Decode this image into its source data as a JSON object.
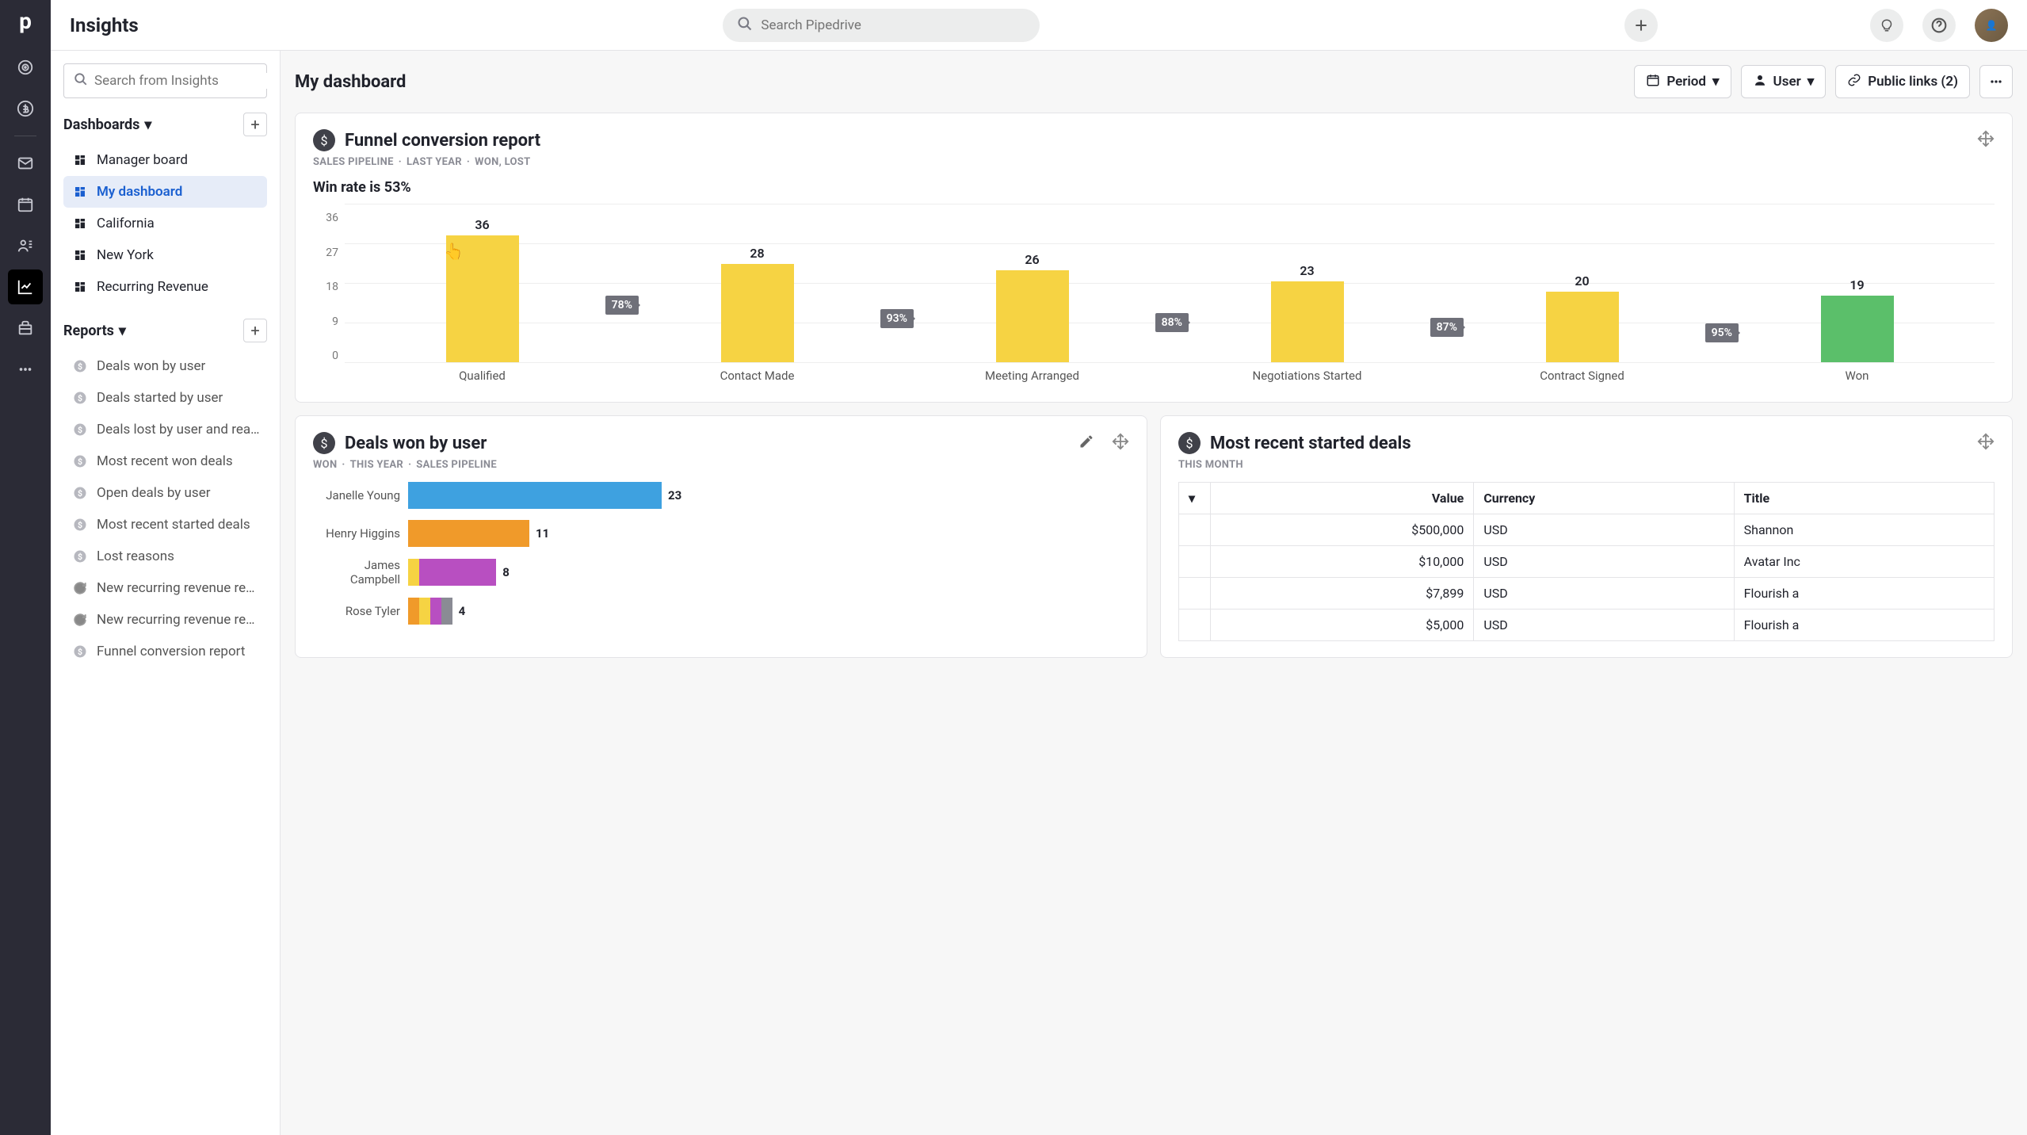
{
  "app": {
    "page_title": "Insights",
    "search_placeholder": "Search Pipedrive"
  },
  "sidebar": {
    "search_placeholder": "Search from Insights",
    "dashboards_label": "Dashboards",
    "reports_label": "Reports",
    "dashboards": [
      {
        "label": "Manager board"
      },
      {
        "label": "My dashboard",
        "active": true
      },
      {
        "label": "California"
      },
      {
        "label": "New York"
      },
      {
        "label": "Recurring Revenue"
      }
    ],
    "reports": [
      {
        "label": "Deals won by user",
        "icon": "dollar"
      },
      {
        "label": "Deals started by user",
        "icon": "dollar"
      },
      {
        "label": "Deals lost by user and rea…",
        "icon": "dollar"
      },
      {
        "label": "Most recent won deals",
        "icon": "dollar"
      },
      {
        "label": "Open deals by user",
        "icon": "dollar"
      },
      {
        "label": "Most recent started deals",
        "icon": "dollar"
      },
      {
        "label": "Lost reasons",
        "icon": "dollar"
      },
      {
        "label": "New recurring revenue re…",
        "icon": "cycle"
      },
      {
        "label": "New recurring revenue re…",
        "icon": "cycle"
      },
      {
        "label": "Funnel conversion report",
        "icon": "dollar"
      }
    ]
  },
  "content": {
    "title": "My dashboard",
    "period_label": "Period",
    "user_label": "User",
    "public_links_label": "Public links (2)"
  },
  "funnel": {
    "title": "Funnel conversion report",
    "meta": [
      "SALES PIPELINE",
      "LAST YEAR",
      "WON, LOST"
    ],
    "winrate": "Win rate is 53%"
  },
  "chart_data": [
    {
      "id": "funnel",
      "type": "bar",
      "ylim": [
        0,
        36
      ],
      "yticks": [
        36,
        27,
        18,
        9,
        0
      ],
      "categories": [
        "Qualified",
        "Contact Made",
        "Meeting Arranged",
        "Negotiations Started",
        "Contract Signed",
        "Won"
      ],
      "values": [
        36,
        28,
        26,
        23,
        20,
        19
      ],
      "conversions": [
        "78%",
        "93%",
        "88%",
        "87%",
        "95%"
      ],
      "won_index": 5
    },
    {
      "id": "deals_won_by_user",
      "type": "bar",
      "orientation": "horizontal",
      "max": 23,
      "series": [
        {
          "name": "Janelle Young",
          "value": 23,
          "segments": [
            {
              "color": "#3ea1e0",
              "w": 23
            }
          ]
        },
        {
          "name": "Henry Higgins",
          "value": 11,
          "segments": [
            {
              "color": "#f09a2a",
              "w": 11
            }
          ]
        },
        {
          "name": "James Campbell",
          "value": 8,
          "segments": [
            {
              "color": "#f6d343",
              "w": 1
            },
            {
              "color": "#b84fc1",
              "w": 7
            }
          ]
        },
        {
          "name": "Rose Tyler",
          "value": 4,
          "segments": [
            {
              "color": "#f09a2a",
              "w": 1
            },
            {
              "color": "#f6d343",
              "w": 1
            },
            {
              "color": "#b84fc1",
              "w": 1
            },
            {
              "color": "#8a8b94",
              "w": 1
            }
          ]
        }
      ]
    }
  ],
  "deals_won": {
    "title": "Deals won by user",
    "meta": [
      "WON",
      "THIS YEAR",
      "SALES PIPELINE"
    ]
  },
  "recent_deals": {
    "title": "Most recent started deals",
    "meta": [
      "THIS MONTH"
    ],
    "columns": [
      "Value",
      "Currency",
      "Title"
    ],
    "rows": [
      {
        "value": "$500,000",
        "currency": "USD",
        "title": "Shannon"
      },
      {
        "value": "$10,000",
        "currency": "USD",
        "title": "Avatar Inc"
      },
      {
        "value": "$7,899",
        "currency": "USD",
        "title": "Flourish a"
      },
      {
        "value": "$5,000",
        "currency": "USD",
        "title": "Flourish a"
      }
    ]
  }
}
